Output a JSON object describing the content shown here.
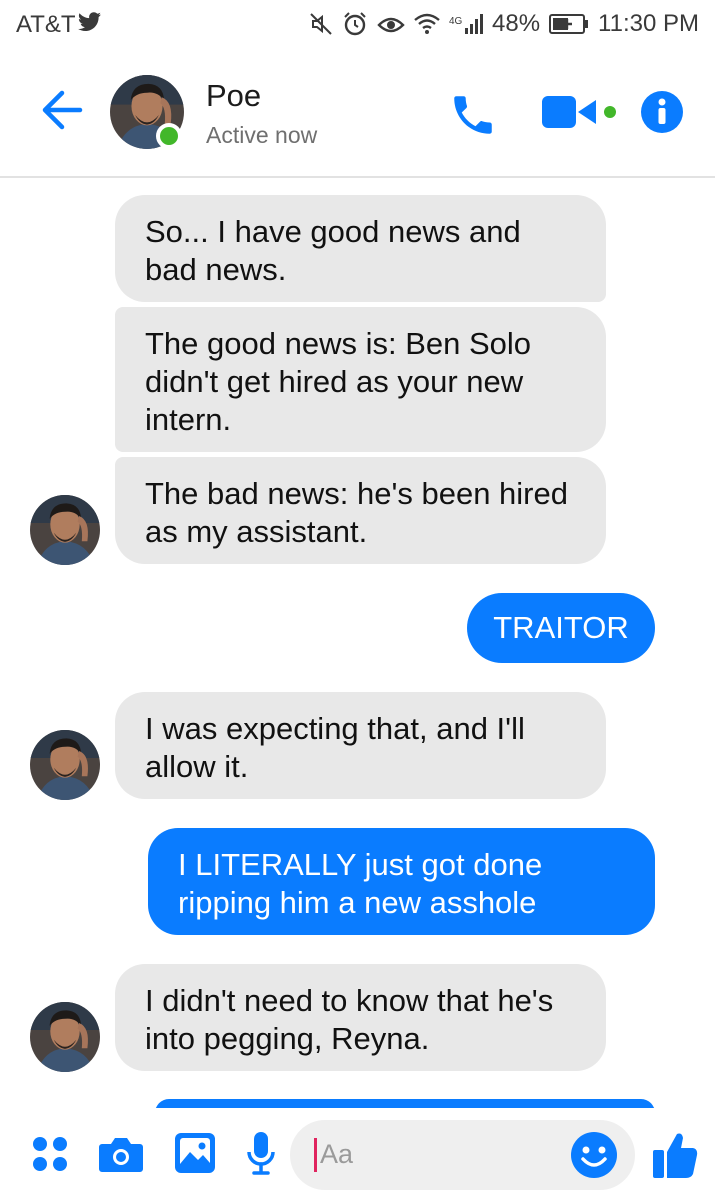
{
  "status_bar": {
    "carrier": "AT&T",
    "battery": "48%",
    "time": "11:30 PM"
  },
  "header": {
    "name": "Poe",
    "status": "Active now"
  },
  "messages": [
    {
      "from": "them",
      "text": "So... I have good news and bad news."
    },
    {
      "from": "them",
      "text": "The good news is: Ben Solo didn't get hired as your new intern."
    },
    {
      "from": "them",
      "text": "The bad news: he's been hired as my assistant."
    },
    {
      "from": "me",
      "text": "TRAITOR"
    },
    {
      "from": "them",
      "text": "I was expecting that, and I'll allow it."
    },
    {
      "from": "me",
      "text": "I LITERALLY just got done ripping him a new asshole"
    },
    {
      "from": "them",
      "text": "I didn't need to know that he's into pegging, Reyna."
    }
  ],
  "composer": {
    "placeholder": "Aa"
  },
  "colors": {
    "accent": "#0a7cff",
    "incoming_bubble": "#e8e8e8",
    "presence": "#42b72a"
  },
  "icons": [
    "back-arrow-icon",
    "phone-icon",
    "video-icon",
    "info-icon",
    "apps-icon",
    "camera-icon",
    "gallery-icon",
    "microphone-icon",
    "emoji-icon",
    "like-icon",
    "twitter-icon",
    "mute-icon",
    "alarm-icon",
    "eye-icon",
    "wifi-icon",
    "signal-icon",
    "battery-icon"
  ]
}
